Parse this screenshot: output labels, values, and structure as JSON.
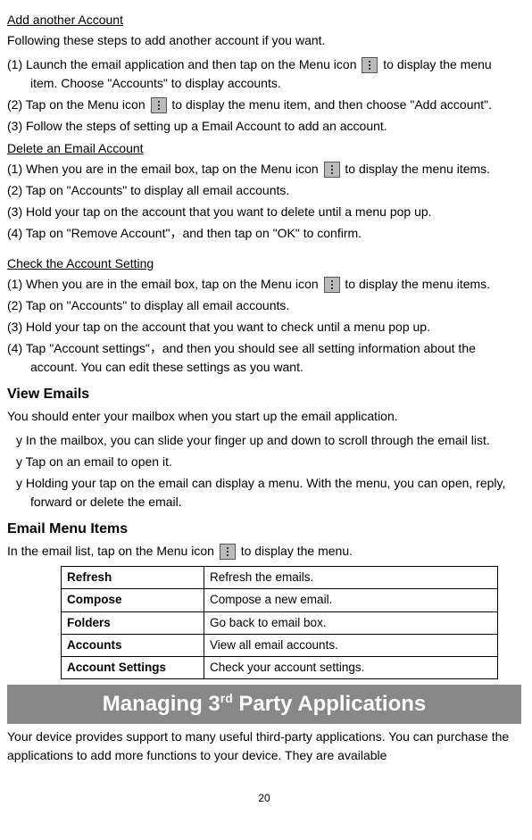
{
  "sections": {
    "addAccount": {
      "title": "Add another Account",
      "intro": "Following these steps to add another account if you want.",
      "steps": {
        "s1a": "(1) Launch the email application and then tap on the Menu icon ",
        "s1b": " to display the menu item. Choose \"Accounts\" to display accounts.",
        "s2a": "(2) Tap on the Menu icon ",
        "s2b": " to display the menu item, and then choose \"Add account\".",
        "s3": "(3) Follow the steps of setting up a Email Account to add an account."
      }
    },
    "deleteAccount": {
      "title": "Delete an Email Account",
      "steps": {
        "s1a": "(1) When you are in the email box, tap on the Menu icon ",
        "s1b": " to display the menu items.",
        "s2": "(2) Tap on \"Accounts\" to display all email accounts.",
        "s3": "(3) Hold your tap on the account that you want to delete until a menu pop up.",
        "s4": "(4) Tap on \"Remove Account\"，and then tap on \"OK\" to confirm."
      }
    },
    "checkSetting": {
      "title": "Check the Account Setting",
      "steps": {
        "s1a": "(1) When you are in the email box, tap on the Menu icon ",
        "s1b": " to display the menu items.",
        "s2": "(2) Tap on \"Accounts\" to display all email accounts.",
        "s3": "(3) Hold your tap on the account that you want to check until a menu pop up.",
        "s4": "(4) Tap \"Account settings\"，and then you should see all setting information about the account. You can edit these settings as you want."
      }
    },
    "viewEmails": {
      "title": "View Emails",
      "intro": "You should enter your mailbox when you start up the email application.",
      "bullets": {
        "b1": "In the mailbox, you can slide your finger up and down to scroll through the email list.",
        "b2": "Tap on an email to open it.",
        "b3": "Holding your tap on the email can display a menu. With the menu, you can open, reply, forward or delete the email."
      }
    },
    "emailMenu": {
      "title": "Email Menu Items",
      "introA": "In the email list, tap on the Menu icon ",
      "introB": " to display the menu.",
      "table": {
        "r1c1": "Refresh",
        "r1c2": "Refresh the emails.",
        "r2c1": "Compose",
        "r2c2": "Compose a new email.",
        "r3c1": "Folders",
        "r3c2": "Go back to email box.",
        "r4c1": "Accounts",
        "r4c2": "View all email accounts.",
        "r5c1": "Account Settings",
        "r5c2": "Check your account settings."
      }
    },
    "managing": {
      "titleA": "Managing 3",
      "titleSup": "rd",
      "titleB": " Party Applications",
      "body": "Your device provides support to many useful third-party applications. You can purchase the applications to add more functions to your device. They are available"
    }
  },
  "pageNumber": "20",
  "bulletChar": "y "
}
